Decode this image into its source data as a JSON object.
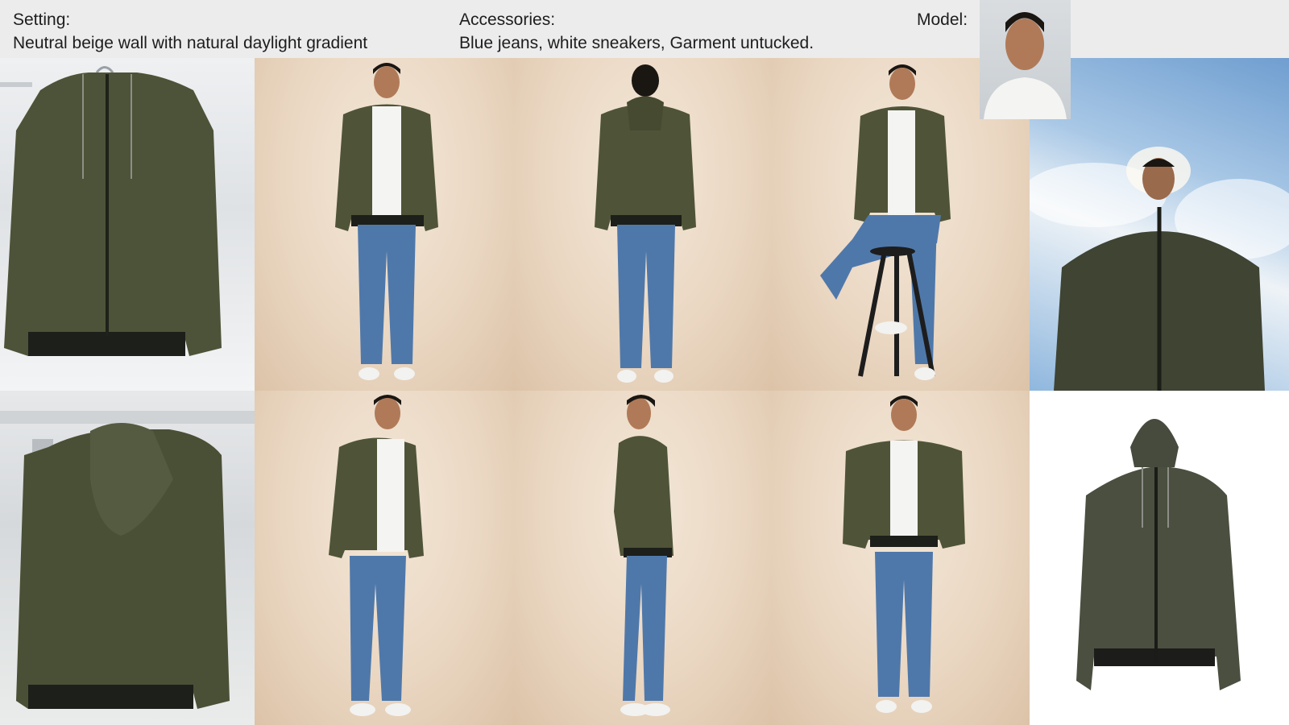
{
  "header": {
    "setting_label": "Setting:",
    "setting_value": "Neutral beige wall with natural daylight gradient",
    "accessories_label": "Accessories:",
    "accessories_value": "Blue jeans, white sneakers, Garment untucked.",
    "model_label": "Model:"
  },
  "colors": {
    "jacket": "#4f5438",
    "jeans": "#4f78aa",
    "shirt": "#f4f4f2",
    "skin": "#b07a58",
    "hair": "#1a1612"
  }
}
